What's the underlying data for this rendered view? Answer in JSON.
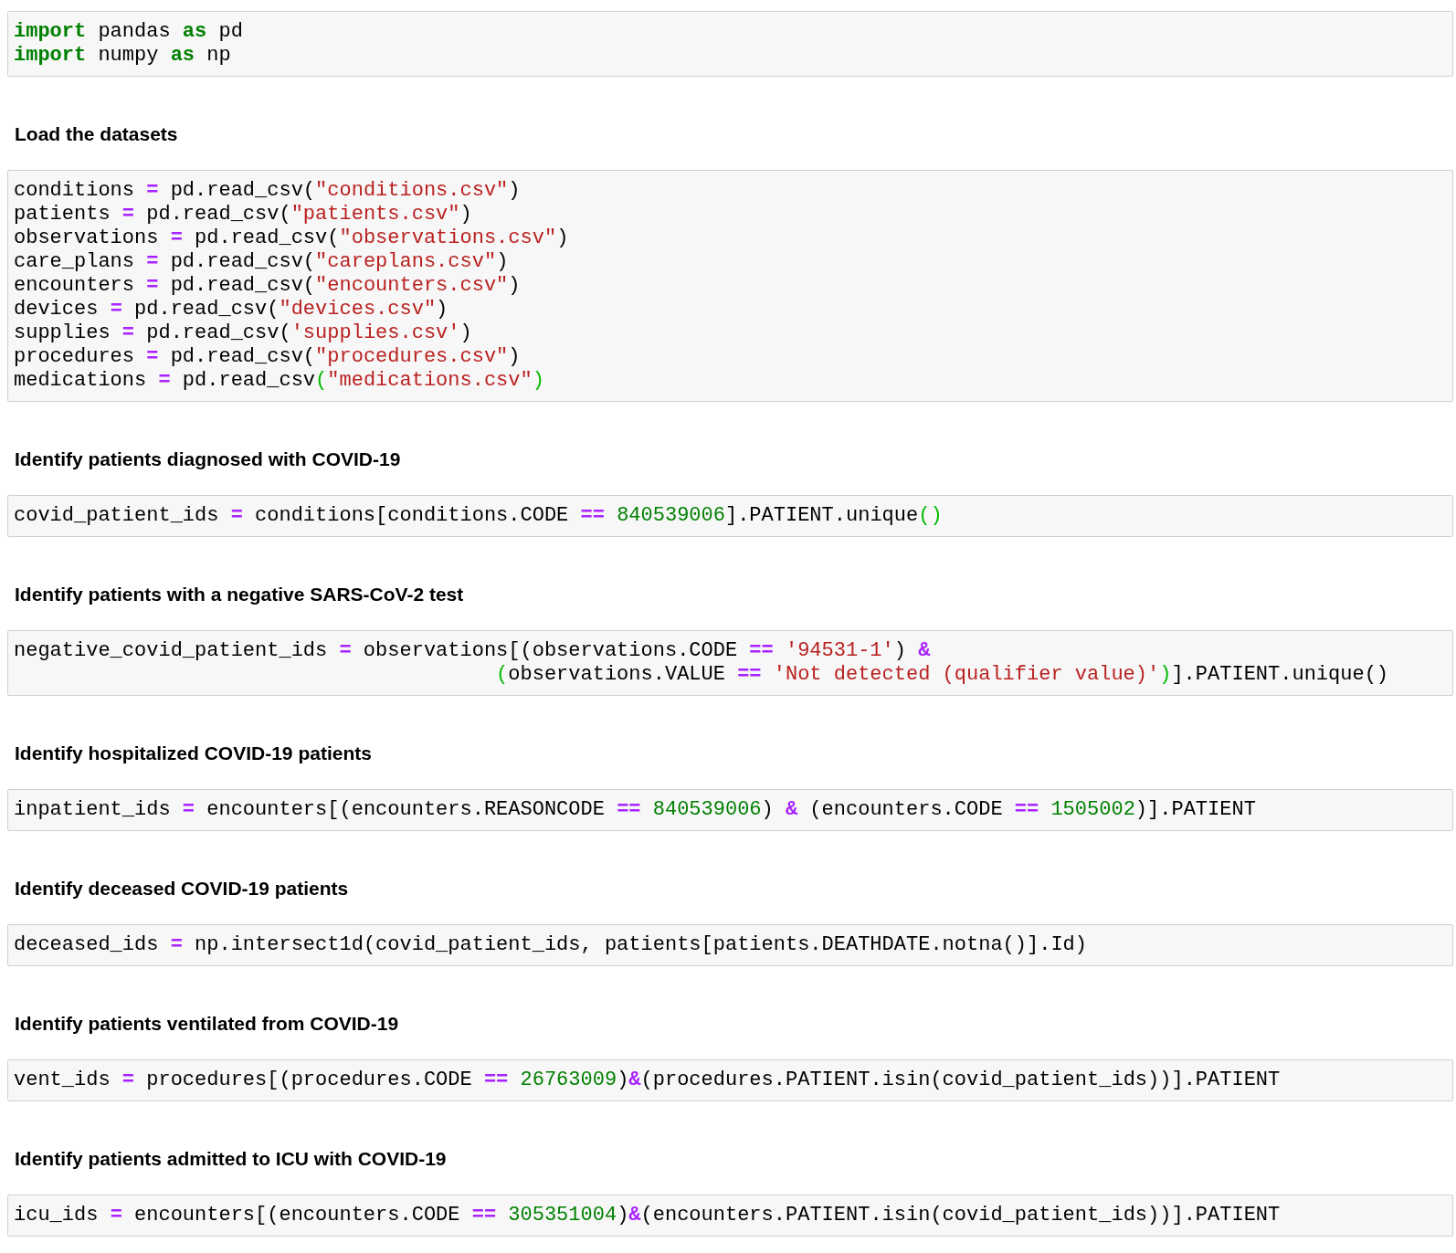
{
  "cells": [
    {
      "kind": "code",
      "lines": [
        [
          {
            "text": "import",
            "kind": "keyword"
          },
          {
            "text": " pandas ",
            "kind": "plain"
          },
          {
            "text": "as",
            "kind": "keyword"
          },
          {
            "text": " pd",
            "kind": "plain"
          }
        ],
        [
          {
            "text": "import",
            "kind": "keyword"
          },
          {
            "text": " numpy ",
            "kind": "plain"
          },
          {
            "text": "as",
            "kind": "keyword"
          },
          {
            "text": " np",
            "kind": "plain"
          }
        ]
      ]
    },
    {
      "kind": "markdown",
      "text": "Load the datasets"
    },
    {
      "kind": "code",
      "lines": [
        [
          {
            "text": "conditions ",
            "kind": "plain"
          },
          {
            "text": "=",
            "kind": "operator"
          },
          {
            "text": " pd.read_csv(",
            "kind": "plain"
          },
          {
            "text": "\"conditions.csv\"",
            "kind": "string"
          },
          {
            "text": ")",
            "kind": "plain"
          }
        ],
        [
          {
            "text": "patients ",
            "kind": "plain"
          },
          {
            "text": "=",
            "kind": "operator"
          },
          {
            "text": " pd.read_csv(",
            "kind": "plain"
          },
          {
            "text": "\"patients.csv\"",
            "kind": "string"
          },
          {
            "text": ")",
            "kind": "plain"
          }
        ],
        [
          {
            "text": "observations ",
            "kind": "plain"
          },
          {
            "text": "=",
            "kind": "operator"
          },
          {
            "text": " pd.read_csv(",
            "kind": "plain"
          },
          {
            "text": "\"observations.csv\"",
            "kind": "string"
          },
          {
            "text": ")",
            "kind": "plain"
          }
        ],
        [
          {
            "text": "care_plans ",
            "kind": "plain"
          },
          {
            "text": "=",
            "kind": "operator"
          },
          {
            "text": " pd.read_csv(",
            "kind": "plain"
          },
          {
            "text": "\"careplans.csv\"",
            "kind": "string"
          },
          {
            "text": ")",
            "kind": "plain"
          }
        ],
        [
          {
            "text": "encounters ",
            "kind": "plain"
          },
          {
            "text": "=",
            "kind": "operator"
          },
          {
            "text": " pd.read_csv(",
            "kind": "plain"
          },
          {
            "text": "\"encounters.csv\"",
            "kind": "string"
          },
          {
            "text": ")",
            "kind": "plain"
          }
        ],
        [
          {
            "text": "devices ",
            "kind": "plain"
          },
          {
            "text": "=",
            "kind": "operator"
          },
          {
            "text": " pd.read_csv(",
            "kind": "plain"
          },
          {
            "text": "\"devices.csv\"",
            "kind": "string"
          },
          {
            "text": ")",
            "kind": "plain"
          }
        ],
        [
          {
            "text": "supplies ",
            "kind": "plain"
          },
          {
            "text": "=",
            "kind": "operator"
          },
          {
            "text": " pd.read_csv(",
            "kind": "plain"
          },
          {
            "text": "'supplies.csv'",
            "kind": "string"
          },
          {
            "text": ")",
            "kind": "plain"
          }
        ],
        [
          {
            "text": "procedures ",
            "kind": "plain"
          },
          {
            "text": "=",
            "kind": "operator"
          },
          {
            "text": " pd.read_csv(",
            "kind": "plain"
          },
          {
            "text": "\"procedures.csv\"",
            "kind": "string"
          },
          {
            "text": ")",
            "kind": "plain"
          }
        ],
        [
          {
            "text": "medications ",
            "kind": "plain"
          },
          {
            "text": "=",
            "kind": "operator"
          },
          {
            "text": " pd.read_csv",
            "kind": "plain"
          },
          {
            "text": "(",
            "kind": "bracket_match"
          },
          {
            "text": "\"medications.csv\"",
            "kind": "string"
          },
          {
            "text": ")",
            "kind": "bracket_match"
          }
        ]
      ]
    },
    {
      "kind": "markdown",
      "text": "Identify patients diagnosed with COVID-19"
    },
    {
      "kind": "code",
      "lines": [
        [
          {
            "text": "covid_patient_ids ",
            "kind": "plain"
          },
          {
            "text": "=",
            "kind": "operator"
          },
          {
            "text": " conditions[conditions.CODE ",
            "kind": "plain"
          },
          {
            "text": "== ",
            "kind": "operator"
          },
          {
            "text": "840539006",
            "kind": "number"
          },
          {
            "text": "].PATIENT.unique",
            "kind": "plain"
          },
          {
            "text": "()",
            "kind": "bracket_match"
          }
        ]
      ]
    },
    {
      "kind": "markdown",
      "text": "Identify patients with a negative SARS-CoV-2 test"
    },
    {
      "kind": "code",
      "lines": [
        [
          {
            "text": "negative_covid_patient_ids ",
            "kind": "plain"
          },
          {
            "text": "=",
            "kind": "operator"
          },
          {
            "text": " observations[(observations.CODE ",
            "kind": "plain"
          },
          {
            "text": "== ",
            "kind": "operator"
          },
          {
            "text": "'94531-1'",
            "kind": "string"
          },
          {
            "text": ") ",
            "kind": "plain"
          },
          {
            "text": "&",
            "kind": "operator"
          }
        ],
        [
          {
            "text": "                                        (",
            "kind": "bracket_match"
          },
          {
            "text": "observations.VALUE ",
            "kind": "plain"
          },
          {
            "text": "== ",
            "kind": "operator"
          },
          {
            "text": "'Not detected (qualifier value)'",
            "kind": "string"
          },
          {
            "text": ")",
            "kind": "bracket_match"
          },
          {
            "text": "].PATIENT.unique()",
            "kind": "plain"
          }
        ]
      ]
    },
    {
      "kind": "markdown",
      "text": "Identify hospitalized COVID-19 patients"
    },
    {
      "kind": "code",
      "lines": [
        [
          {
            "text": "inpatient_ids ",
            "kind": "plain"
          },
          {
            "text": "=",
            "kind": "operator"
          },
          {
            "text": " encounters[(encounters.REASONCODE ",
            "kind": "plain"
          },
          {
            "text": "== ",
            "kind": "operator"
          },
          {
            "text": "840539006",
            "kind": "number"
          },
          {
            "text": ") ",
            "kind": "plain"
          },
          {
            "text": "&",
            "kind": "operator"
          },
          {
            "text": " (encounters.CODE ",
            "kind": "plain"
          },
          {
            "text": "== ",
            "kind": "operator"
          },
          {
            "text": "1505002",
            "kind": "number"
          },
          {
            "text": ")].PATIENT",
            "kind": "plain"
          }
        ]
      ]
    },
    {
      "kind": "markdown",
      "text": "Identify deceased COVID-19 patients"
    },
    {
      "kind": "code",
      "lines": [
        [
          {
            "text": "deceased_ids ",
            "kind": "plain"
          },
          {
            "text": "=",
            "kind": "operator"
          },
          {
            "text": " np.intersect1d(covid_patient_ids, patients[patients.DEATHDATE.notna()].Id)",
            "kind": "plain"
          }
        ]
      ]
    },
    {
      "kind": "markdown",
      "text": "Identify patients ventilated from COVID-19"
    },
    {
      "kind": "code",
      "lines": [
        [
          {
            "text": "vent_ids ",
            "kind": "plain"
          },
          {
            "text": "=",
            "kind": "operator"
          },
          {
            "text": " procedures[(procedures.CODE ",
            "kind": "plain"
          },
          {
            "text": "== ",
            "kind": "operator"
          },
          {
            "text": "26763009",
            "kind": "number"
          },
          {
            "text": ")",
            "kind": "plain"
          },
          {
            "text": "&",
            "kind": "operator"
          },
          {
            "text": "(procedures.PATIENT.isin(covid_patient_ids))].PATIENT",
            "kind": "plain"
          }
        ]
      ]
    },
    {
      "kind": "markdown",
      "text": "Identify patients admitted to ICU with COVID-19"
    },
    {
      "kind": "code",
      "lines": [
        [
          {
            "text": "icu_ids ",
            "kind": "plain"
          },
          {
            "text": "=",
            "kind": "operator"
          },
          {
            "text": " encounters[(encounters.CODE ",
            "kind": "plain"
          },
          {
            "text": "== ",
            "kind": "operator"
          },
          {
            "text": "305351004",
            "kind": "number"
          },
          {
            "text": ")",
            "kind": "plain"
          },
          {
            "text": "&",
            "kind": "operator"
          },
          {
            "text": "(encounters.PATIENT.isin(covid_patient_ids))].PATIENT",
            "kind": "plain"
          }
        ]
      ]
    }
  ]
}
